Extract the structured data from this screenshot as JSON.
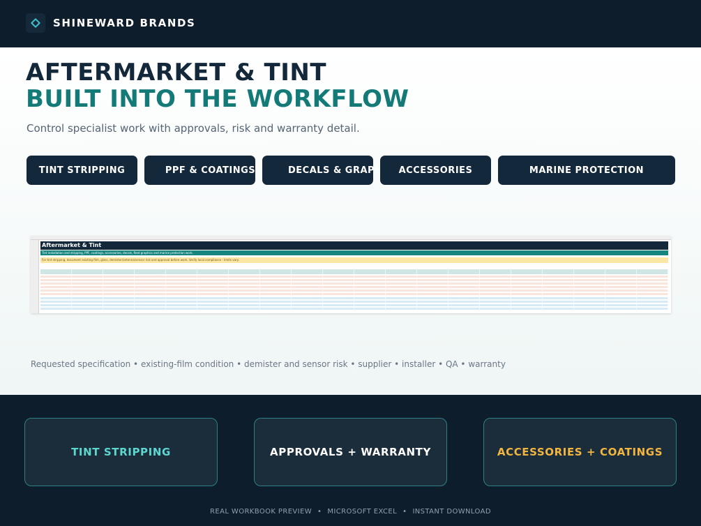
{
  "brand": {
    "name": "SHINEWARD BRANDS"
  },
  "hero": {
    "title_line1": "AFTERMARKET & TINT",
    "title_line2": "BUILT INTO THE WORKFLOW",
    "subtitle": "Control specialist work with approvals, risk and warranty detail."
  },
  "tabs": [
    {
      "label": "TINT STRIPPING"
    },
    {
      "label": "PPF & COATINGS"
    },
    {
      "label": "DECALS & GRAPHICS"
    },
    {
      "label": "ACCESSORIES"
    },
    {
      "label": "MARINE PROTECTION"
    }
  ],
  "preview": {
    "sheet_title": "Aftermarket & Tint",
    "band1": "Tint installation and stripping, PPF, coatings, accessories, decals, fleet graphics and marine protection work.",
    "band2": "For tint stripping, document existing film, glass, demister/antenna/sensor risk and approval before work. Verify local compliance - limits vary."
  },
  "caption": "Requested specification • existing-film condition • demister and sensor risk • supplier • installer • QA • warranty",
  "cards": [
    {
      "label": "TINT STRIPPING",
      "color": "#5ed6d0"
    },
    {
      "label": "APPROVALS + WARRANTY",
      "color": "#ffffff"
    },
    {
      "label": "ACCESSORIES + COATINGS",
      "color": "#f2b640"
    }
  ],
  "footer": {
    "item1": "REAL WORKBOOK PREVIEW",
    "item2": "MICROSOFT EXCEL",
    "item3": "INSTANT DOWNLOAD",
    "separator": "•"
  },
  "colors": {
    "navy": "#0e1d2c",
    "teal": "#137a78",
    "tab_bg": "#13283a"
  }
}
